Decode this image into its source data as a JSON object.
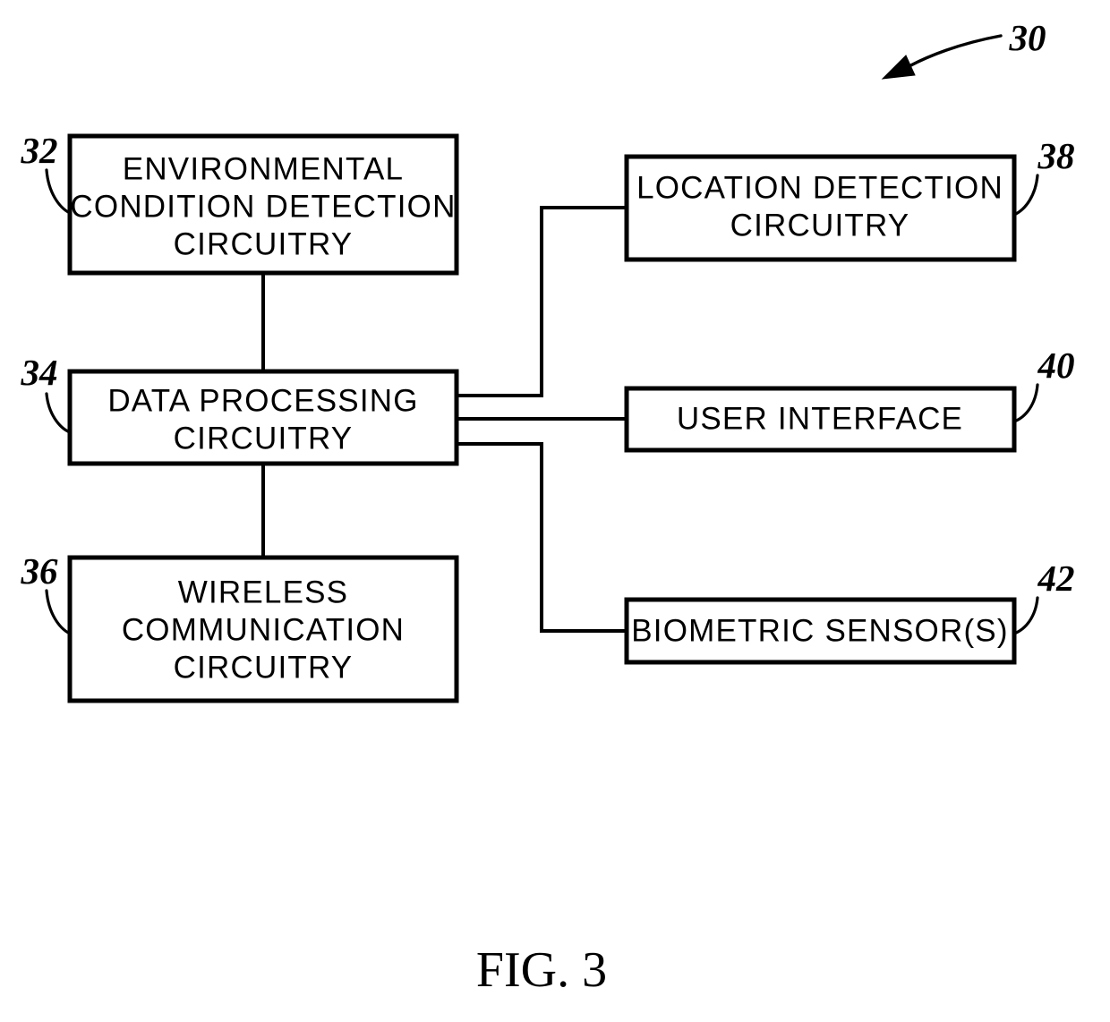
{
  "figure": {
    "caption": "FIG. 3",
    "system_ref": "30"
  },
  "blocks": [
    {
      "id": "environmental-condition-detection-circuitry",
      "ref": "32",
      "lines": [
        "ENVIRONMENTAL",
        "CONDITION  DETECTION",
        "CIRCUITRY"
      ]
    },
    {
      "id": "data-processing-circuitry",
      "ref": "34",
      "lines": [
        "DATA  PROCESSING",
        "CIRCUITRY"
      ]
    },
    {
      "id": "wireless-communication-circuitry",
      "ref": "36",
      "lines": [
        "WIRELESS",
        "COMMUNICATION",
        "CIRCUITRY"
      ]
    },
    {
      "id": "location-detection-circuitry",
      "ref": "38",
      "lines": [
        "LOCATION  DETECTION",
        "CIRCUITRY"
      ]
    },
    {
      "id": "user-interface",
      "ref": "40",
      "lines": [
        "USER  INTERFACE"
      ]
    },
    {
      "id": "biometric-sensors",
      "ref": "42",
      "lines": [
        "BIOMETRIC  SENSOR(S)"
      ]
    }
  ],
  "colors": {
    "ink": "#000000",
    "paper": "#ffffff"
  }
}
